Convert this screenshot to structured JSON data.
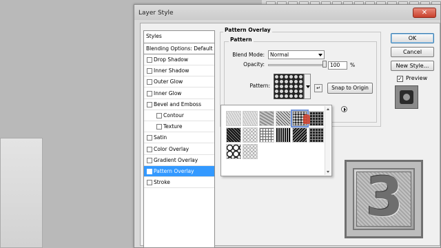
{
  "window": {
    "title": "Layer Style"
  },
  "styles_list": {
    "header": "Styles",
    "blending": "Blending Options: Default",
    "items": [
      {
        "label": "Drop Shadow",
        "checked": false,
        "sub": false
      },
      {
        "label": "Inner Shadow",
        "checked": false,
        "sub": false
      },
      {
        "label": "Outer Glow",
        "checked": false,
        "sub": false
      },
      {
        "label": "Inner Glow",
        "checked": false,
        "sub": false
      },
      {
        "label": "Bevel and Emboss",
        "checked": false,
        "sub": false
      },
      {
        "label": "Contour",
        "checked": false,
        "sub": true
      },
      {
        "label": "Texture",
        "checked": false,
        "sub": true
      },
      {
        "label": "Satin",
        "checked": false,
        "sub": false
      },
      {
        "label": "Color Overlay",
        "checked": false,
        "sub": false
      },
      {
        "label": "Gradient Overlay",
        "checked": false,
        "sub": false
      },
      {
        "label": "Pattern Overlay",
        "checked": true,
        "sub": false,
        "active": true
      },
      {
        "label": "Stroke",
        "checked": false,
        "sub": false
      }
    ],
    "checkmark": "✓"
  },
  "pattern_overlay": {
    "title": "Pattern Overlay",
    "group": "Pattern",
    "blend_mode_label": "Blend Mode:",
    "blend_mode_value": "Normal",
    "opacity_label": "Opacity:",
    "opacity_value": "100",
    "opacity_unit": "%",
    "opacity_level": 1.0,
    "pattern_label": "Pattern:",
    "new_preset_glyph": "↵",
    "snap_button": "Snap to Origin"
  },
  "picker": {
    "swatches": [
      {
        "name": "pattern-swatch-1",
        "style": "noise-light"
      },
      {
        "name": "pattern-swatch-2",
        "style": "noise-light"
      },
      {
        "name": "pattern-swatch-3",
        "style": "noise-mid"
      },
      {
        "name": "pattern-swatch-4",
        "style": "diag-light"
      },
      {
        "name": "pattern-swatch-5",
        "style": "dots-dark",
        "selected": true
      },
      {
        "name": "pattern-swatch-6",
        "style": "grid-dark"
      },
      {
        "name": "pattern-swatch-7",
        "style": "weave-dark"
      },
      {
        "name": "pattern-swatch-8",
        "style": "hex-light"
      },
      {
        "name": "pattern-swatch-9",
        "style": "grid-light"
      },
      {
        "name": "pattern-swatch-10",
        "style": "bars-dark"
      },
      {
        "name": "pattern-swatch-11",
        "style": "diag-dark"
      },
      {
        "name": "pattern-swatch-12",
        "style": "grid-dark"
      },
      {
        "name": "pattern-swatch-13",
        "style": "web-dark"
      },
      {
        "name": "pattern-swatch-14",
        "style": "hex-light"
      }
    ]
  },
  "actions": {
    "ok": "OK",
    "cancel": "Cancel",
    "new_style": "New Style...",
    "preview_label": "Preview",
    "preview_checked": true
  },
  "logo": {
    "glyph": "3"
  },
  "colors": {
    "selection": "#3399ff",
    "close": "#c8402c"
  }
}
